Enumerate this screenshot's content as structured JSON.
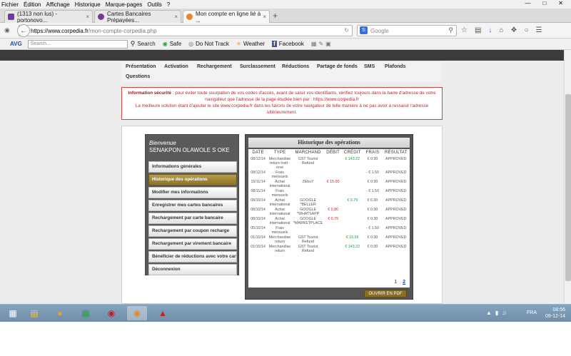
{
  "menubar": [
    "Fichier",
    "Édition",
    "Affichage",
    "Historique",
    "Marque-pages",
    "Outils",
    "?"
  ],
  "tabs": [
    {
      "label": "(1313 non lus) - portonovo...",
      "icon_color": "#6b3fa0"
    },
    {
      "label": "Cartes Bancaires Prépayées...",
      "icon_color": "#7a3a8c"
    },
    {
      "label": "Mon compte en ligne lié à ...",
      "icon_color": "#e4882a"
    }
  ],
  "tab_close": "×",
  "new_tab": "+",
  "url": {
    "host": "https://www.corpedia.fr",
    "path": "/mon-compte-corpedia.php"
  },
  "search": {
    "placeholder": "Google"
  },
  "avg": {
    "logo": "AVG",
    "search_placeholder": "Search...",
    "search_button": "Search",
    "items": [
      "Safe",
      "Do Not Track",
      "Weather",
      "Facebook"
    ]
  },
  "site_nav": [
    "Présentation",
    "Activation",
    "Rechargement",
    "Surclassement",
    "Réductions",
    "Partage de fonds",
    "SMS",
    "Plafonds",
    "Questions"
  ],
  "security": {
    "title": "Information sécurité",
    "line1": " : pour éviter toute usurpation de vos codes d'accès, avant de saisir vos identifiants, vérifiez toujours dans la barre d'adresse de votre",
    "line2": "navigateur que l'adresse de la page étudiée bien par : https://www.corpedia.fr",
    "line3": "La meilleure solution étant d'ajouter le site www.corpedia.fr dans les favoris de votre navigateur de telle manière à ne pas avoir à ressaisir l'adresse",
    "line4": "ultérieurement."
  },
  "sidebar": {
    "welcome": "Bienvenue",
    "username": "SENAKPON OLAWOLE S OKE",
    "items": [
      "Informations générales",
      "Historique des opérations",
      "Modifier mes informations",
      "Enregistrer mes cartes bancaires",
      "Rechargement par carte bancaire",
      "Rechargement par coupon recharge",
      "Rechargement par virement bancaire",
      "Bénéficier de réductions avec votre carte",
      "Déconnexion"
    ],
    "active_index": 1
  },
  "history": {
    "title": "Historique des opérations",
    "columns": [
      "DATE",
      "TYPE",
      "MARCHAND",
      "DÉBIT",
      "CRÉDIT",
      "FRAIS",
      "RÉSULTAT"
    ],
    "rows": [
      [
        "08/12/14",
        "Merchandise return Instl - reve",
        "GST Tourist Refund",
        "",
        "€ 143.22",
        "€ 0.00",
        "APPROVED"
      ],
      [
        "08/12/14",
        "Frais mensuels",
        "",
        "",
        "",
        "- € 1.50",
        "APPROVED"
      ],
      [
        "15/11/14",
        "Achat international",
        "ZEbuY",
        "€ 15.00",
        "",
        "€ 0.00",
        "APPROVED"
      ],
      [
        "08/11/14",
        "Frais mensuels",
        "",
        "",
        "",
        "- € 1.50",
        "APPROVED"
      ],
      [
        "08/10/14",
        "Achat international",
        "GOOGLE *BELLER",
        "",
        "€ 0.79",
        "€ 0.00",
        "APPROVED"
      ],
      [
        "08/10/14",
        "Achat international",
        "GOOGLE *WHATSAPP",
        "€ 0.80",
        "",
        "€ 0.00",
        "APPROVED"
      ],
      [
        "08/10/14",
        "Achat international",
        "GOOGLE *MARKETPLACE",
        "€ 0.79",
        "",
        "€ 0.00",
        "APPROVED"
      ],
      [
        "05/10/14",
        "Frais mensuels",
        "",
        "",
        "",
        "- € 1.50",
        "APPROVED"
      ],
      [
        "01/10/14",
        "Merchandise return",
        "GST Tourist Refund",
        "",
        "€ 15.56",
        "€ 0.00",
        "APPROVED"
      ],
      [
        "01/10/14",
        "Merchandise return",
        "GST Tourist Refund",
        "",
        "€ 143.22",
        "€ 0.00",
        "APPROVED"
      ]
    ],
    "pages": [
      "1",
      "2"
    ],
    "pdf_button": "OUVRIR EN PDF"
  },
  "taskbar": {
    "lang": "FRA",
    "time": "08:56",
    "date": "09-12-14"
  },
  "colors": {
    "accent_gold": "#8c6d1e",
    "warning_red": "#c0262c",
    "credit_green": "#1b9b3b",
    "debit_red": "#cc2222"
  }
}
